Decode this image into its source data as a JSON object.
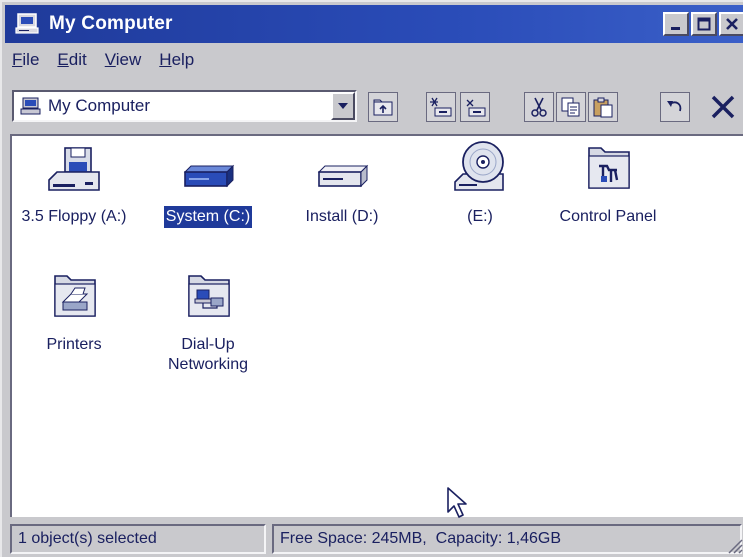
{
  "window": {
    "title": "My Computer"
  },
  "menu": [
    {
      "label": "File",
      "key": "F",
      "rest": "ile"
    },
    {
      "label": "Edit",
      "key": "E",
      "rest": "dit"
    },
    {
      "label": "View",
      "key": "V",
      "rest": "iew"
    },
    {
      "label": "Help",
      "key": "H",
      "rest": "elp"
    }
  ],
  "address": {
    "value": "My Computer"
  },
  "toolbar_icons": [
    "up-folder-icon",
    "map-drive-icon",
    "disconnect-drive-icon",
    "cut-icon",
    "copy-icon",
    "paste-icon",
    "undo-icon",
    "delete-icon"
  ],
  "items": [
    {
      "label": "3.5 Floppy (A:)",
      "icon": "floppy-drive-icon",
      "selected": false
    },
    {
      "label": "System (C:)",
      "icon": "hard-drive-icon",
      "selected": true
    },
    {
      "label": "Install (D:)",
      "icon": "hard-drive-icon",
      "selected": false
    },
    {
      "label": "(E:)",
      "icon": "cd-drive-icon",
      "selected": false
    },
    {
      "label": "Control Panel",
      "icon": "control-panel-folder-icon",
      "selected": false
    },
    {
      "label": "Printers",
      "icon": "printers-folder-icon",
      "selected": false
    },
    {
      "label": "Dial-Up\nNetworking",
      "icon": "dialup-folder-icon",
      "selected": false
    }
  ],
  "status": {
    "left": "1 object(s) selected",
    "right": "Free Space: 245MB,  Capacity: 1,46GB"
  },
  "colors": {
    "titlebar": "#1f3a9a",
    "selection": "#1f3a9a",
    "text": "#1a2060"
  }
}
